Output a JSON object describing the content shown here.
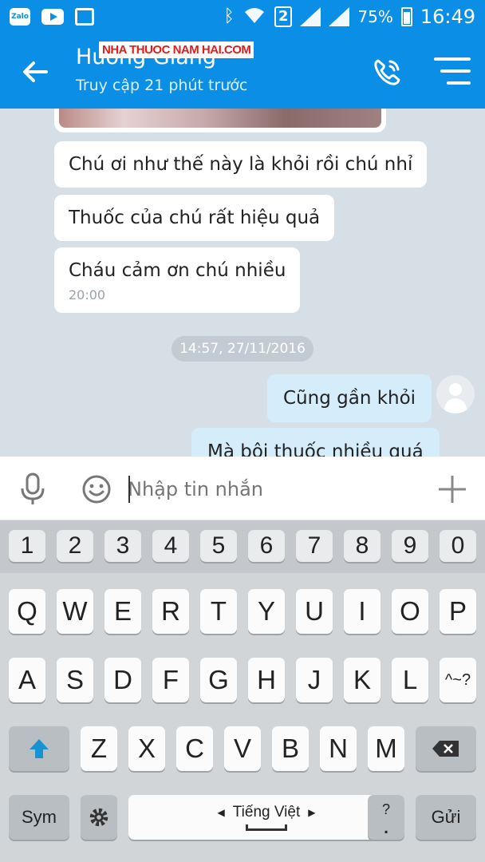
{
  "status_bar": {
    "app_icons": [
      "zalo-icon",
      "youtube-icon",
      "store-icon"
    ],
    "zalo_label": "Zalo",
    "sim_indicator": "2",
    "battery_percent": "75%",
    "battery_level": 0.75,
    "time": "16:49"
  },
  "header": {
    "title": "Hương Giang",
    "subtitle": "Truy cập 21 phút trước",
    "watermark": "NHA THUOC NAM HAI.COM"
  },
  "messages": {
    "incoming": [
      {
        "text": "Chú ơi như thế này là khỏi rồi chú nhỉ"
      },
      {
        "text": "Thuốc của chú rất hiệu quả"
      },
      {
        "text": "Cháu cảm ơn chú nhiều",
        "time": "20:00"
      }
    ],
    "date_separator": "14:57, 27/11/2016",
    "outgoing": [
      {
        "text": "Cũng gần khỏi"
      },
      {
        "text": "Mà bôi thuốc nhiều quá"
      }
    ]
  },
  "input": {
    "placeholder": "Nhập tin nhắn"
  },
  "keyboard": {
    "numbers": [
      "1",
      "2",
      "3",
      "4",
      "5",
      "6",
      "7",
      "8",
      "9",
      "0"
    ],
    "row1": [
      "Q",
      "W",
      "E",
      "R",
      "T",
      "Y",
      "U",
      "I",
      "O",
      "P"
    ],
    "row2": [
      "A",
      "S",
      "D",
      "F",
      "G",
      "H",
      "J",
      "K",
      "L"
    ],
    "row3": [
      "Z",
      "X",
      "C",
      "V",
      "B",
      "N",
      "M"
    ],
    "sym_label": "Sym",
    "language_label": "Tiếng Việt",
    "send_label": "Gửi",
    "tone_key": "^~?",
    "punct_key": "?",
    "dot_key": "."
  },
  "colors": {
    "accent": "#0a8ee6",
    "chat_bg": "#d7dfe6",
    "outgoing_bubble": "#d5ecfb",
    "shift_arrow": "#1793d1"
  }
}
